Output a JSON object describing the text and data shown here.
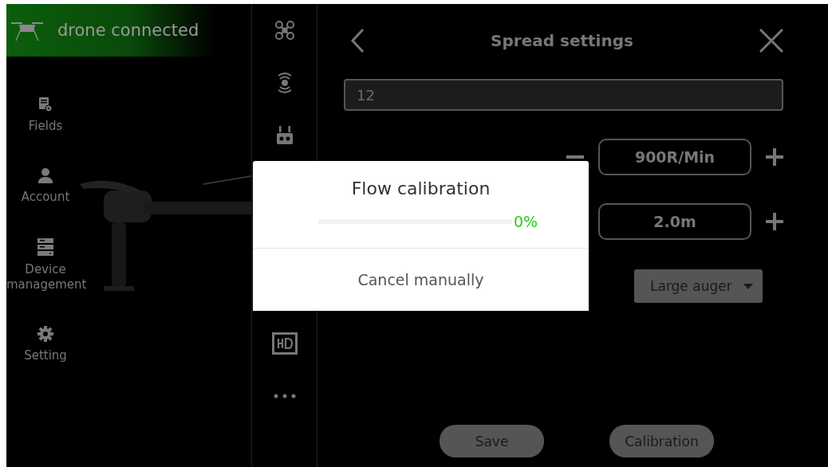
{
  "status": {
    "label": "drone connected"
  },
  "sidebar": {
    "items": [
      {
        "label": "Fields",
        "kind": "fields"
      },
      {
        "label": "Account",
        "kind": "account"
      },
      {
        "label": "Device management",
        "kind": "device"
      },
      {
        "label": "Setting",
        "kind": "setting"
      }
    ]
  },
  "toolbar": {
    "items": [
      {
        "kind": "drone"
      },
      {
        "kind": "signal"
      },
      {
        "kind": "remote"
      },
      {
        "kind": "hd"
      },
      {
        "kind": "more"
      }
    ]
  },
  "panel": {
    "title": "Spread settings",
    "name_field": {
      "value": "12"
    },
    "rows": [
      {
        "kind": "stepper",
        "value": "900R/Min"
      },
      {
        "kind": "stepper",
        "value": "2.0m"
      },
      {
        "kind": "dropdown",
        "value": "Large auger"
      }
    ],
    "buttons": [
      "Save",
      "Calibration"
    ]
  },
  "dialog": {
    "title": "Flow calibration",
    "level": 0,
    "reading": "0%",
    "button": "Cancel manually"
  }
}
